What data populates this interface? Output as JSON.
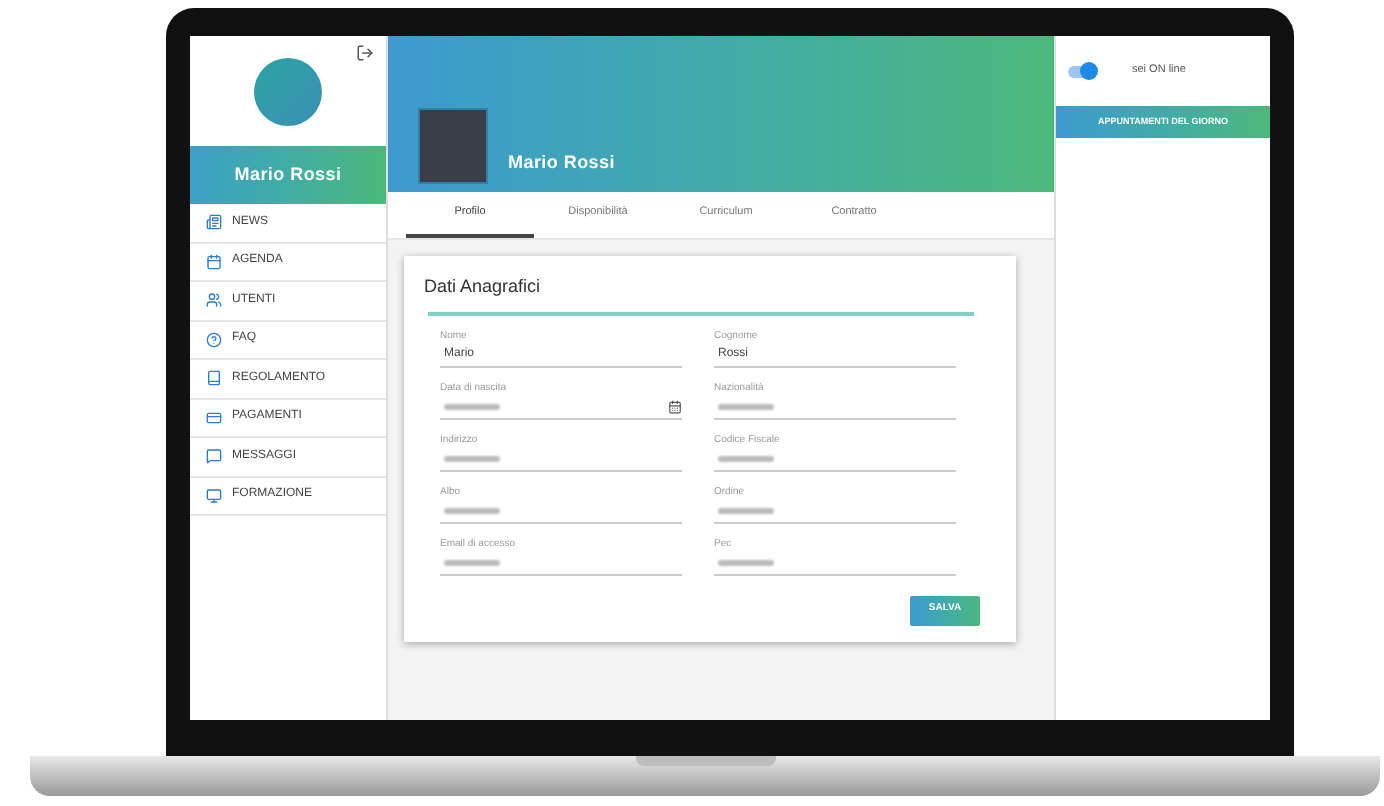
{
  "sidebar": {
    "user_name": "Mario Rossi",
    "items": [
      {
        "label": "NEWS",
        "selected": false
      },
      {
        "label": "AGENDA",
        "selected": false
      },
      {
        "label": "UTENTI",
        "selected": false
      },
      {
        "label": "FAQ",
        "selected": false
      },
      {
        "label": "REGOLAMENTO",
        "selected": false
      },
      {
        "label": "PAGAMENTI",
        "selected": false
      },
      {
        "label": "MESSAGGI",
        "selected": false
      },
      {
        "label": "FORMAZIONE",
        "selected": false
      }
    ]
  },
  "profile": {
    "name": "Mario Rossi"
  },
  "tabs": [
    {
      "label": "Profilo",
      "selected": true
    },
    {
      "label": "Disponibilità",
      "selected": false
    },
    {
      "label": "Curriculum",
      "selected": false
    },
    {
      "label": "Contratto",
      "selected": false
    }
  ],
  "form": {
    "title": "Dati Anagrafici",
    "fields": [
      {
        "label": "Nome",
        "value": "Mario",
        "kind": "text"
      },
      {
        "label": "Cognome",
        "value": "Rossi",
        "kind": "text"
      },
      {
        "label": "Data di nascita",
        "kind": "date"
      },
      {
        "label": "Nazionalità",
        "kind": "text"
      },
      {
        "label": "Indirizzo",
        "kind": "text"
      },
      {
        "label": "Codice Fiscale",
        "kind": "text"
      },
      {
        "label": "Albo",
        "kind": "text"
      },
      {
        "label": "Ordine",
        "kind": "text"
      },
      {
        "label": "Email di accesso",
        "kind": "text"
      },
      {
        "label": "Pec",
        "kind": "text"
      }
    ],
    "save_button": "SALVA"
  },
  "right_panel": {
    "status_toggle": {
      "label": "sei ON line",
      "on": true
    },
    "appointments_header": "APPUNTAMENTI DEL GIORNO"
  }
}
